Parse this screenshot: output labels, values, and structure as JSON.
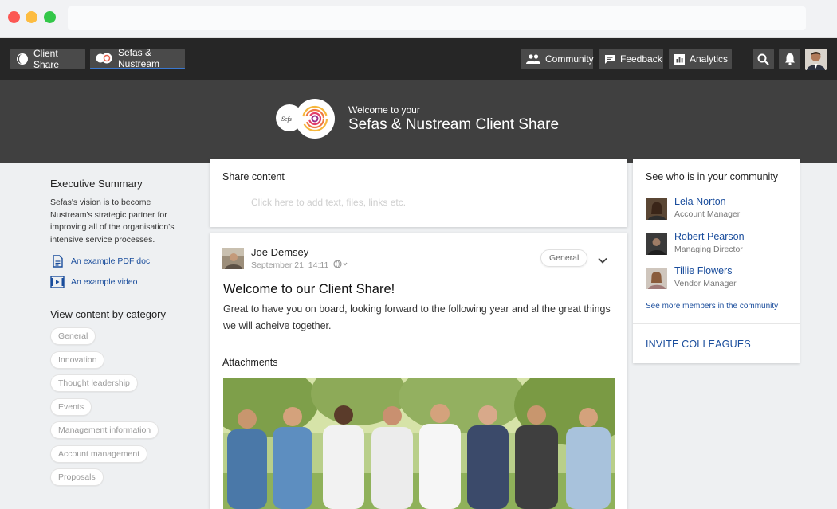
{
  "nav": {
    "left": [
      {
        "label": "Client Share",
        "icon": "client-share-logo-icon"
      },
      {
        "label": "Sefas & Nustream",
        "icon": "sefas-logo-icon"
      }
    ],
    "right": [
      {
        "label": "Community",
        "icon": "community-icon"
      },
      {
        "label": "Feedback",
        "icon": "feedback-icon"
      },
      {
        "label": "Analytics",
        "icon": "analytics-icon"
      }
    ]
  },
  "banner": {
    "welcome_small": "Welcome to your",
    "welcome_big": "Sefas & Nustream Client Share",
    "logo_text": "Sefs"
  },
  "sidebar": {
    "exec_title": "Executive Summary",
    "exec_text": "Sefas's vision is to become Nustream's strategic partner for improving all of the organisation's intensive service processes.",
    "links": [
      {
        "label": "An example PDF doc",
        "icon": "pdf-document-icon"
      },
      {
        "label": "An example video",
        "icon": "video-icon"
      }
    ],
    "category_title": "View content by category",
    "categories": [
      "General",
      "Innovation",
      "Thought leadership",
      "Events",
      "Management information",
      "Account management",
      "Proposals"
    ]
  },
  "share": {
    "title": "Share content",
    "placeholder": "Click here to add text, files, links etc."
  },
  "post": {
    "author": "Joe Demsey",
    "date": "September 21, 14:11",
    "category": "General",
    "title": "Welcome to our Client Share!",
    "body": "Great to have you on board, looking forward to the following year and al the great things we will acheive together.",
    "attachments_title": "Attachments"
  },
  "community": {
    "title": "See who is in your community",
    "members": [
      {
        "name": "Lela Norton",
        "role": "Account Manager"
      },
      {
        "name": "Robert Pearson",
        "role": "Managing Director"
      },
      {
        "name": "Tillie Flowers",
        "role": "Vendor Manager"
      }
    ],
    "see_more": "See more members in the community",
    "invite": "INVITE COLLEAGUES"
  },
  "colors": {
    "nav_bg": "#262626",
    "banner_bg": "#404040",
    "link_blue": "#1a4d9c",
    "page_bg": "#eef0f2"
  }
}
